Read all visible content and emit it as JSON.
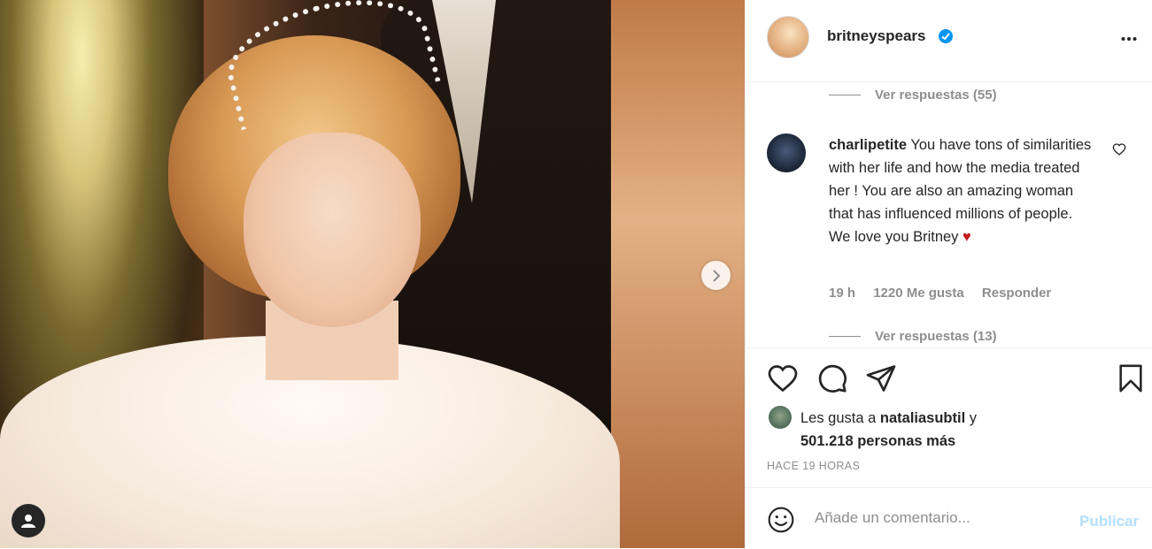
{
  "post": {
    "username": "britneyspears",
    "more_icon": "more-options-icon",
    "verified_color": "#0095f6"
  },
  "media": {
    "next_icon": "chevron-right-icon",
    "tag_icon": "user-tag-icon"
  },
  "comments": {
    "view_replies_1": "Ver respuestas (55)",
    "item": {
      "username": "charlipetite",
      "text": "You have tons of similarities with her life and how the media treated her ! You are also an amazing woman that has influenced millions of people. We love you Britney",
      "emoji": "♥",
      "time": "19 h",
      "likes": "1220 Me gusta",
      "reply": "Responder"
    },
    "view_replies_2": "Ver respuestas (13)"
  },
  "actions": {
    "like_icon": "heart-icon",
    "comment_icon": "comment-icon",
    "share_icon": "share-icon",
    "save_icon": "bookmark-icon"
  },
  "likes": {
    "prefix": "Les gusta a",
    "user": "nataliasubtil",
    "conj": "y",
    "count": "501.218 personas más"
  },
  "timestamp": "HACE 19 HORAS",
  "add_comment": {
    "placeholder": "Añade un comentario...",
    "publish": "Publicar",
    "emoji_icon": "emoji-icon"
  }
}
